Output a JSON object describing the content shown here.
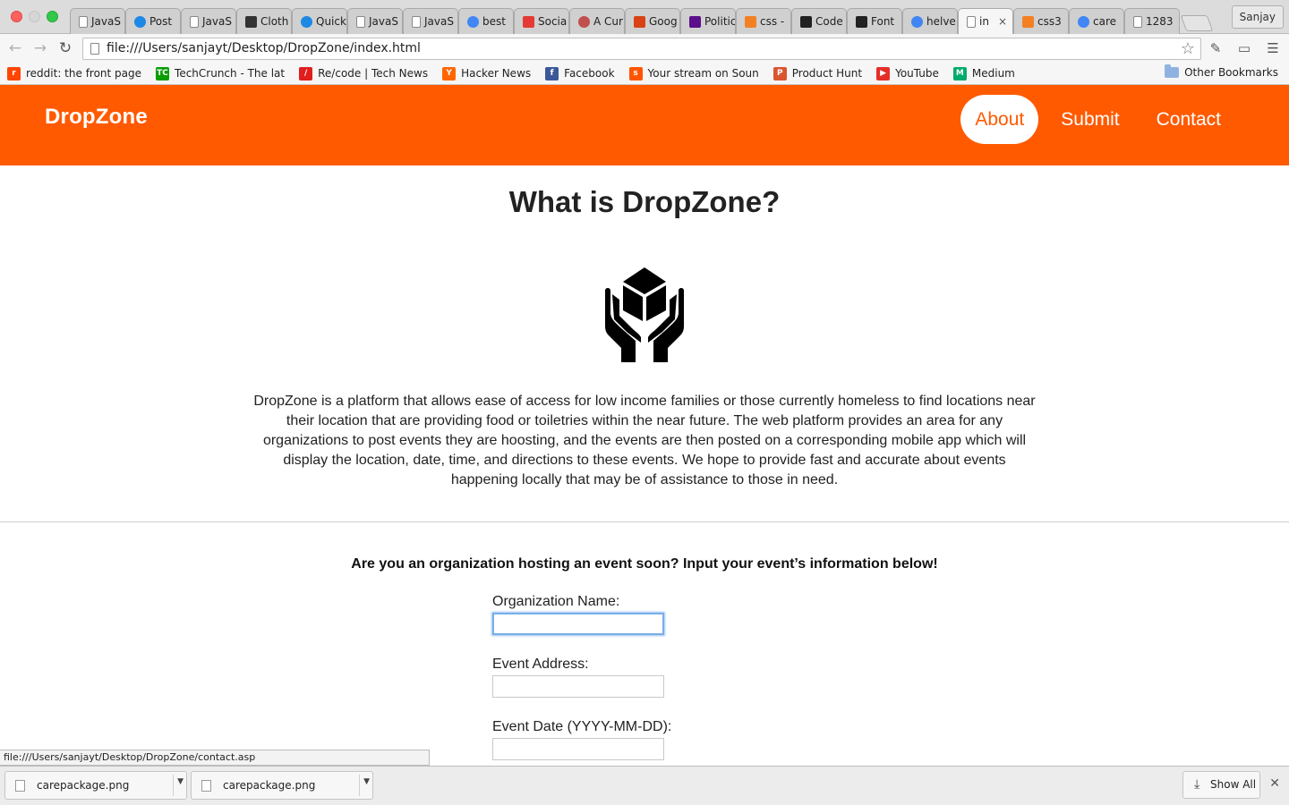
{
  "browser": {
    "tabs": [
      {
        "label": "JavaS",
        "icon": "page",
        "color": "#888888"
      },
      {
        "label": "Post",
        "icon": "p-circle",
        "color": "#1e88e5"
      },
      {
        "label": "JavaS",
        "icon": "page",
        "color": "#888888"
      },
      {
        "label": "Cloth",
        "icon": "cup",
        "color": "#333333"
      },
      {
        "label": "Quick",
        "icon": "p-circle",
        "color": "#1e88e5"
      },
      {
        "label": "JavaS",
        "icon": "page",
        "color": "#888888"
      },
      {
        "label": "JavaS",
        "icon": "page",
        "color": "#888888"
      },
      {
        "label": "best",
        "icon": "google",
        "color": "#4285f4"
      },
      {
        "label": "Socia",
        "icon": "grid",
        "color": "#e53935"
      },
      {
        "label": "A Cur",
        "icon": "circle",
        "color": "#c0504d"
      },
      {
        "label": "Goog",
        "icon": "square",
        "color": "#d84315"
      },
      {
        "label": "Politic",
        "icon": "yahoo",
        "color": "#5c0f8b"
      },
      {
        "label": "css -",
        "icon": "stack",
        "color": "#f48024"
      },
      {
        "label": "Code",
        "icon": "codepen",
        "color": "#222222"
      },
      {
        "label": "Font",
        "icon": "diamond",
        "color": "#222222"
      },
      {
        "label": "helve",
        "icon": "google",
        "color": "#4285f4"
      },
      {
        "label": "in",
        "icon": "page",
        "color": "#888888",
        "active": true
      },
      {
        "label": "css3",
        "icon": "stack",
        "color": "#f48024"
      },
      {
        "label": "care",
        "icon": "google",
        "color": "#4285f4"
      },
      {
        "label": "1283",
        "icon": "page",
        "color": "#888888"
      }
    ],
    "profile_name": "Sanjay",
    "url": "file:///Users/sanjayt/Desktop/DropZone/index.html",
    "bookmarks": [
      {
        "label": "reddit: the front page",
        "color": "#ff4500",
        "glyph": "r"
      },
      {
        "label": "TechCrunch - The lat",
        "color": "#0a9e01",
        "glyph": "TC"
      },
      {
        "label": "Re/code | Tech News",
        "color": "#e11d1d",
        "glyph": "/"
      },
      {
        "label": "Hacker News",
        "color": "#ff6600",
        "glyph": "Y"
      },
      {
        "label": "Facebook",
        "color": "#3b5998",
        "glyph": "f"
      },
      {
        "label": "Your stream on Soun",
        "color": "#ff5500",
        "glyph": "s"
      },
      {
        "label": "Product Hunt",
        "color": "#da552f",
        "glyph": "P"
      },
      {
        "label": "YouTube",
        "color": "#e52d27",
        "glyph": "▶"
      },
      {
        "label": "Medium",
        "color": "#00ab6c",
        "glyph": "M"
      }
    ],
    "other_bookmarks": "Other Bookmarks",
    "status_url": "file:///Users/sanjayt/Desktop/DropZone/contact.asp",
    "downloads": [
      {
        "name": "carepackage.png"
      },
      {
        "name": "carepackage.png"
      }
    ],
    "show_all": "Show All"
  },
  "site": {
    "brand": "DropZone",
    "accent": "#ff5a00",
    "nav": [
      {
        "label": "About",
        "active": true
      },
      {
        "label": "Submit",
        "active": false
      },
      {
        "label": "Contact",
        "active": false
      }
    ],
    "heading": "What is DropZone?",
    "description": "DropZone is a platform that allows ease of access for low income families or those currently homeless to find locations near their location that are providing food or toiletries within the near future. The web platform provides an area for any organizations to post events they are hoosting, and the events are then posted on a corresponding mobile app which will display the location, date, time, and directions to these events. We hope to provide fast and accurate about events happening locally that may be of assistance to those in need.",
    "form_prompt": "Are you an organization hosting an event soon? Input your event’s information below!",
    "form": {
      "org_label": "Organization Name:",
      "org_value": "",
      "address_label": "Event Address:",
      "address_value": "",
      "date_label": "Event Date (YYYY-MM-DD):",
      "date_value": ""
    }
  }
}
